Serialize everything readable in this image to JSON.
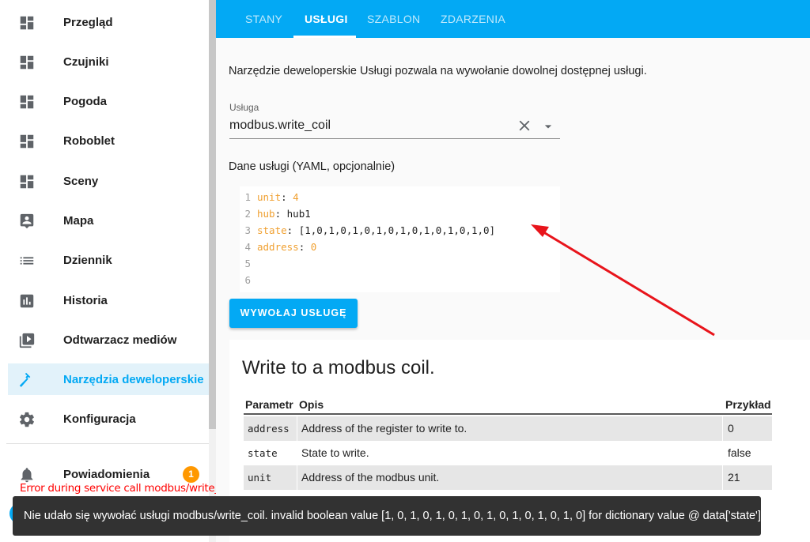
{
  "sidebar": {
    "items": [
      {
        "label": "Przegląd",
        "icon": "dashboard-icon"
      },
      {
        "label": "Czujniki",
        "icon": "dashboard-icon"
      },
      {
        "label": "Pogoda",
        "icon": "dashboard-icon"
      },
      {
        "label": "Roboblet",
        "icon": "dashboard-icon"
      },
      {
        "label": "Sceny",
        "icon": "dashboard-icon"
      },
      {
        "label": "Mapa",
        "icon": "account-box-icon"
      },
      {
        "label": "Dziennik",
        "icon": "list-icon"
      },
      {
        "label": "Historia",
        "icon": "chart-box-icon"
      },
      {
        "label": "Odtwarzacz mediów",
        "icon": "play-box-icon"
      },
      {
        "label": "Narzędzia deweloperskie",
        "icon": "hammer-icon"
      },
      {
        "label": "Konfiguracja",
        "icon": "gear-icon"
      }
    ],
    "notifications": {
      "label": "Powiadomienia",
      "count": "1",
      "icon": "bell-icon"
    }
  },
  "overlay_error": "Error during service call modbus/write_coil...",
  "toolbar": {
    "tabs": [
      "STANY",
      "USŁUGI",
      "SZABLON",
      "ZDARZENIA"
    ],
    "active_tab": "USŁUGI"
  },
  "main": {
    "intro": "Narzędzie deweloperskie Usługi pozwala na wywołanie dowolnej dostępnej usługi.",
    "service_label": "Usługa",
    "service_value": "modbus.write_coil",
    "yaml_label": "Dane usługi (YAML, opcjonalnie)",
    "editor": {
      "line_numbers": [
        "1",
        "2",
        "3",
        "4",
        "5",
        "6"
      ],
      "lines": [
        {
          "key": "unit",
          "value": "4"
        },
        {
          "key": "hub",
          "value": "hub1"
        },
        {
          "key": "state",
          "value": "[1,0,1,0,1,0,1,0,1,0,1,0,1,0,1,0]"
        },
        {
          "key": "address",
          "value": "0"
        }
      ]
    },
    "call_button": "WYWOŁAJ USŁUGĘ"
  },
  "card": {
    "title": "Write to a modbus coil.",
    "headers": [
      "Parametr",
      "Opis",
      "Przykład"
    ],
    "rows": [
      {
        "param": "address",
        "desc": "Address of the register to write to.",
        "example": "0"
      },
      {
        "param": "state",
        "desc": "State to write.",
        "example": "false"
      },
      {
        "param": "unit",
        "desc": "Address of the modbus unit.",
        "example": "21"
      }
    ]
  },
  "snackbar": {
    "message": "Nie udało się wywołać usługi modbus/write_coil. invalid boolean value [1, 0, 1, 0, 1, 0, 1, 0, 1, 0, 1, 0, 1, 0, 1, 0] for dictionary value @ data['state']"
  },
  "colors": {
    "primary": "#03a9f4",
    "badge": "#ff9800",
    "arrow": "#e8141b",
    "snackbar": "#323232"
  }
}
